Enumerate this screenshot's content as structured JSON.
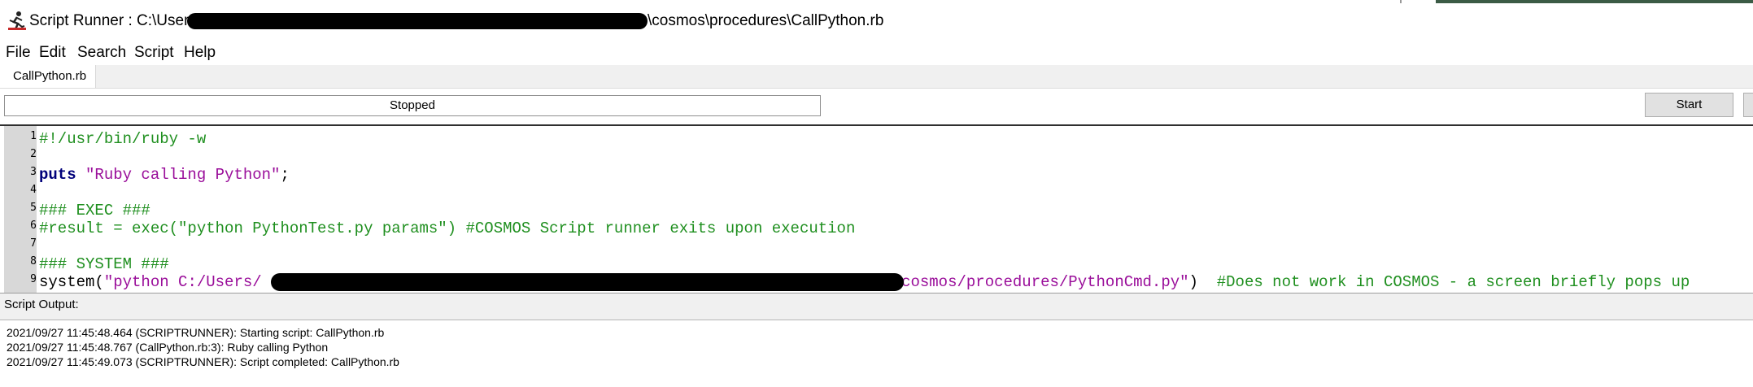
{
  "window": {
    "title_prefix": "Script Runner : C:\\Users\\",
    "title_suffix": "\\cosmos\\procedures\\CallPython.rb"
  },
  "menu": [
    "File",
    "Edit",
    "Search",
    "Script",
    "Help"
  ],
  "tabs": [
    {
      "label": "CallPython.rb"
    }
  ],
  "toolbar": {
    "status": "Stopped",
    "start_label": "Start"
  },
  "editor": {
    "line_numbers": [
      "1",
      "2",
      "3",
      "4",
      "5",
      "6",
      "7",
      "8",
      "9"
    ],
    "lines": {
      "l1": "#!/usr/bin/ruby -w",
      "l3_kw": "puts",
      "l3_str": "\"Ruby calling Python\"",
      "l3_end": ";",
      "l5": "### EXEC ###",
      "l6": "#result = exec(\"python PythonTest.py params\") #COSMOS Script runner exits upon execution",
      "l8": "### SYSTEM ###",
      "l9_start": "system(",
      "l9_str_a": "\"python C:/Users/",
      "l9_str_b": "/cosmos/procedures/PythonCmd.py\"",
      "l9_close": ")",
      "l9_comment": "#Does not work in COSMOS - a screen briefly pops up"
    }
  },
  "output": {
    "label": "Script Output:",
    "lines": [
      "2021/09/27 11:45:48.464 (SCRIPTRUNNER): Starting script: CallPython.rb",
      "2021/09/27 11:45:48.767 (CallPython.rb:3): Ruby calling Python",
      "2021/09/27 11:45:49.073 (SCRIPTRUNNER): Script completed: CallPython.rb"
    ]
  },
  "icons": {
    "app": "runner-icon"
  }
}
